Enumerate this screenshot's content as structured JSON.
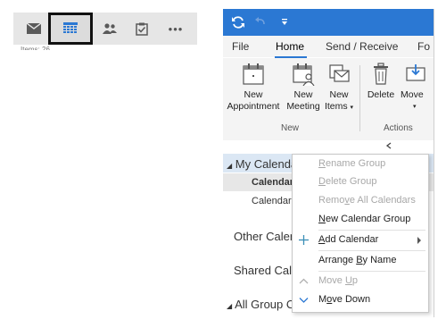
{
  "navbar": {
    "items": [
      {
        "name": "mail",
        "icon": "mail-icon"
      },
      {
        "name": "calendar",
        "icon": "calendar-icon",
        "selected": true
      },
      {
        "name": "people",
        "icon": "people-icon"
      },
      {
        "name": "tasks",
        "icon": "tasks-icon"
      },
      {
        "name": "more",
        "icon": "more-icon",
        "label": "•••"
      }
    ],
    "items_label": "Items: 26"
  },
  "window": {
    "titlebar_color": "#2b78d3",
    "tabs": [
      "File",
      "Home",
      "Send / Receive",
      "Fo"
    ],
    "active_tab": "Home",
    "ribbon": {
      "new_group_label": "New",
      "actions_group_label": "Actions",
      "new_appointment": [
        "New",
        "Appointment"
      ],
      "new_meeting": [
        "New",
        "Meeting"
      ],
      "new_items": [
        "New",
        "Items"
      ],
      "delete": "Delete",
      "move": "Move"
    },
    "folder_pane": {
      "my_calendars": "My Calendars",
      "calendar_1": "Calendar",
      "calendar_2": "Calendar",
      "other_calendars": "Other Calendars",
      "shared_calendars": "Shared Calendars",
      "all_group": "All Group Calendars"
    }
  },
  "context_menu": {
    "items": [
      {
        "label": "Rename Group",
        "enabled": false,
        "u": "R"
      },
      {
        "label": "Delete Group",
        "enabled": false,
        "u": "D"
      },
      {
        "label": "Remove All Calendars",
        "enabled": false,
        "u": "v"
      },
      {
        "label": "New Calendar Group",
        "enabled": true,
        "u": "N"
      },
      {
        "label": "Add Calendar",
        "enabled": true,
        "u": "A",
        "submenu": true,
        "icon": "plus-icon"
      },
      {
        "label": "Arrange By Name",
        "enabled": true,
        "u": "B"
      },
      {
        "label": "Move Up",
        "enabled": false,
        "u": "U",
        "icon": "chevron-up-icon"
      },
      {
        "label": "Move Down",
        "enabled": true,
        "u": "o",
        "icon": "chevron-down-icon"
      }
    ]
  }
}
